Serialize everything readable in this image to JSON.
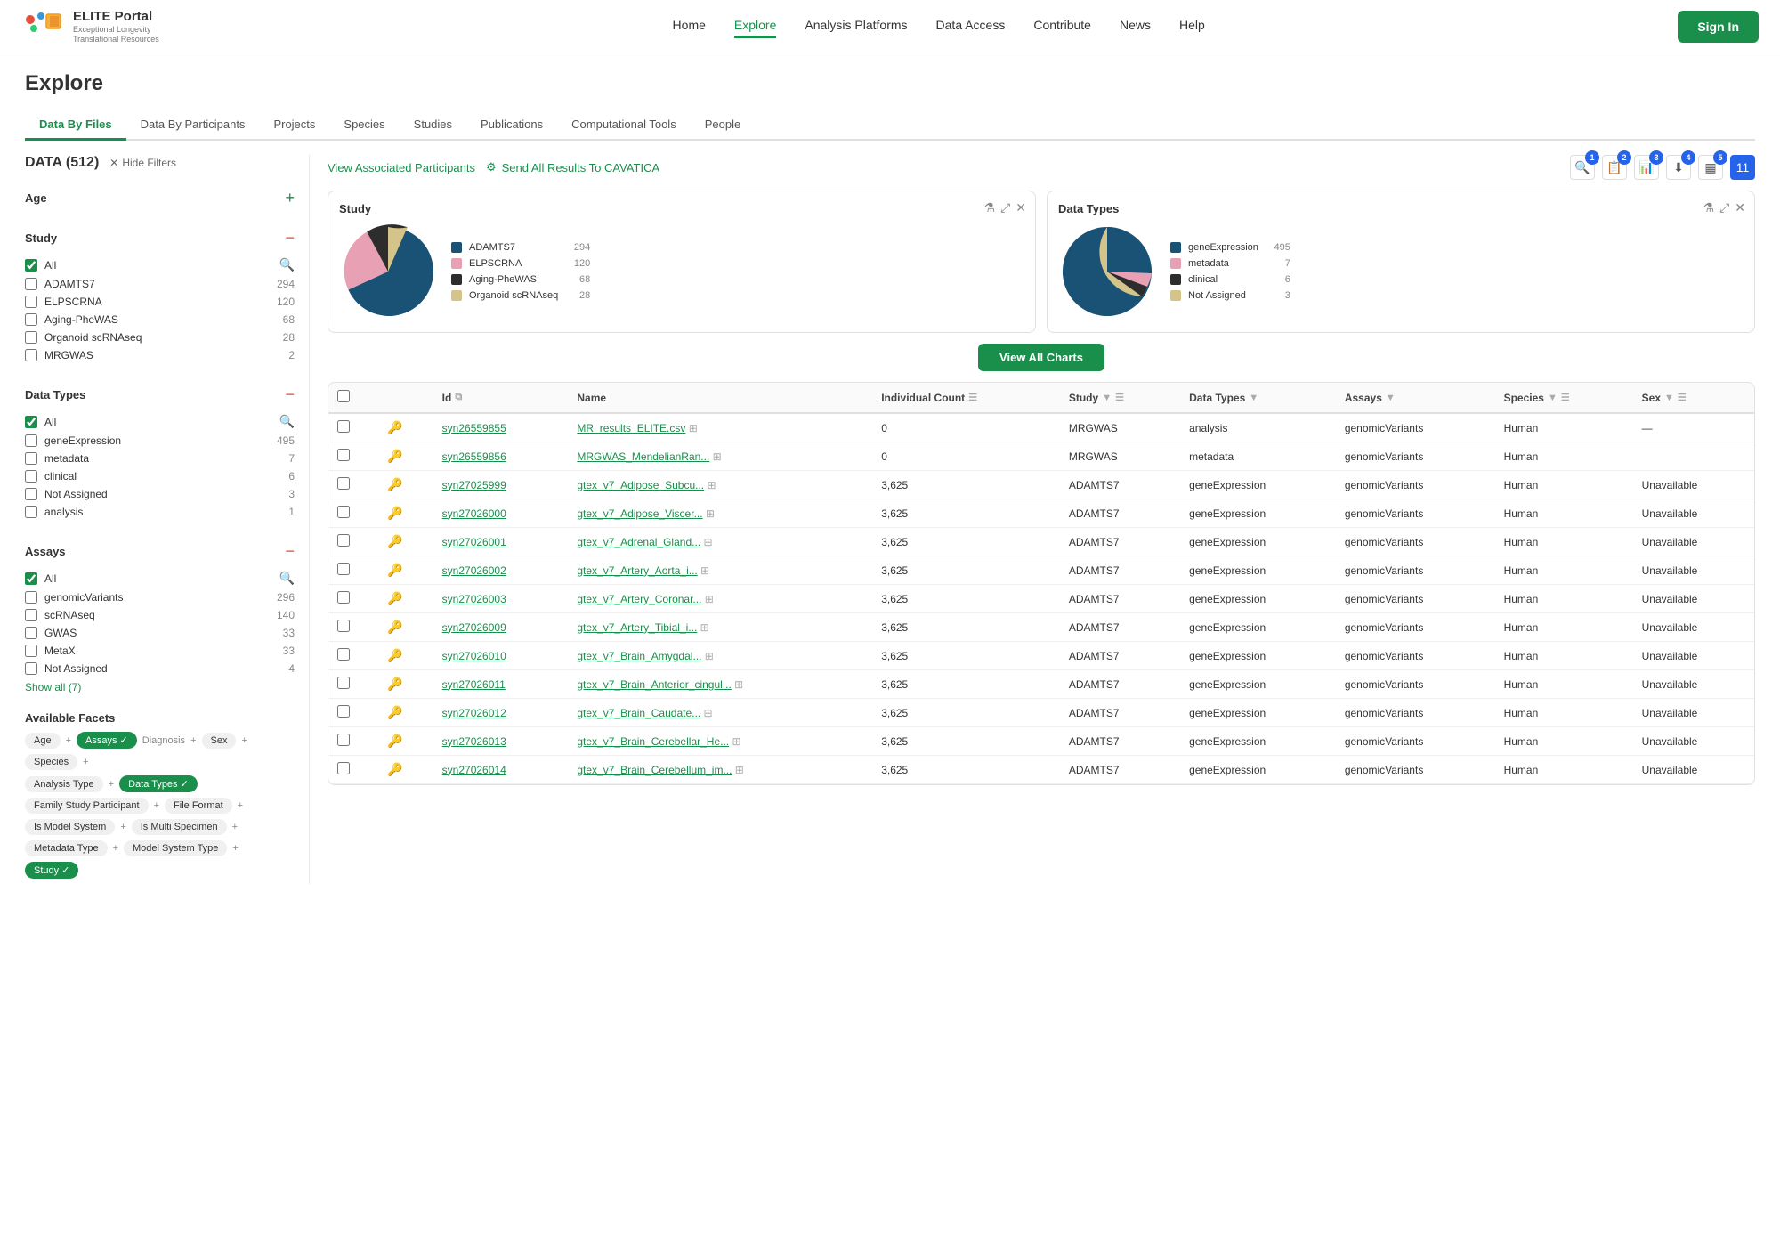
{
  "header": {
    "logo_name": "ELITE Portal",
    "logo_sub": "Exceptional Longevity\nTranslational Resources",
    "nav": [
      {
        "label": "Home",
        "active": false
      },
      {
        "label": "Explore",
        "active": true
      },
      {
        "label": "Analysis Platforms",
        "active": false
      },
      {
        "label": "Data Access",
        "active": false
      },
      {
        "label": "Contribute",
        "active": false
      },
      {
        "label": "News",
        "active": false
      },
      {
        "label": "Help",
        "active": false
      }
    ],
    "sign_in": "Sign In"
  },
  "page": {
    "title": "Explore",
    "tabs": [
      {
        "label": "Data By Files",
        "active": true
      },
      {
        "label": "Data By Participants",
        "active": false
      },
      {
        "label": "Projects",
        "active": false
      },
      {
        "label": "Species",
        "active": false
      },
      {
        "label": "Studies",
        "active": false
      },
      {
        "label": "Publications",
        "active": false
      },
      {
        "label": "Computational Tools",
        "active": false
      },
      {
        "label": "People",
        "active": false
      }
    ]
  },
  "sidebar": {
    "data_count": "DATA (512)",
    "hide_filters": "Hide Filters",
    "sections": [
      {
        "title": "Age",
        "collapsed": false,
        "icon": "+",
        "items": []
      },
      {
        "title": "Study",
        "collapsed": false,
        "icon": "−",
        "has_search": true,
        "items": [
          {
            "label": "All",
            "count": "",
            "checked": true,
            "is_all": true
          },
          {
            "label": "ADAMTS7",
            "count": "294",
            "checked": false
          },
          {
            "label": "ELPSCRNA",
            "count": "120",
            "checked": false
          },
          {
            "label": "Aging-PheWAS",
            "count": "68",
            "checked": false
          },
          {
            "label": "Organoid scRNAseq",
            "count": "28",
            "checked": false
          },
          {
            "label": "MRGWAS",
            "count": "2",
            "checked": false
          }
        ]
      },
      {
        "title": "Data Types",
        "collapsed": false,
        "icon": "−",
        "has_search": true,
        "items": [
          {
            "label": "All",
            "count": "",
            "checked": true,
            "is_all": true
          },
          {
            "label": "geneExpression",
            "count": "495",
            "checked": false
          },
          {
            "label": "metadata",
            "count": "7",
            "checked": false
          },
          {
            "label": "clinical",
            "count": "6",
            "checked": false
          },
          {
            "label": "Not Assigned",
            "count": "3",
            "checked": false
          },
          {
            "label": "analysis",
            "count": "1",
            "checked": false
          }
        ]
      },
      {
        "title": "Assays",
        "collapsed": false,
        "icon": "−",
        "has_search": true,
        "items": [
          {
            "label": "All",
            "count": "",
            "checked": true,
            "is_all": true
          },
          {
            "label": "genomicVariants",
            "count": "296",
            "checked": false
          },
          {
            "label": "scRNAseq",
            "count": "140",
            "checked": false
          },
          {
            "label": "GWAS",
            "count": "33",
            "checked": false
          },
          {
            "label": "MetaX",
            "count": "33",
            "checked": false
          },
          {
            "label": "Not Assigned",
            "count": "4",
            "checked": false
          }
        ],
        "show_all": "Show all (7)"
      }
    ],
    "facets": {
      "title": "Available Facets",
      "rows": [
        [
          {
            "label": "Age",
            "active": false
          },
          {
            "label": "+",
            "is_plus": true
          },
          {
            "label": "Assays",
            "active": true
          },
          {
            "label": "✓",
            "is_check": true
          },
          {
            "label": "Diagnosis",
            "active": false
          },
          {
            "label": "+",
            "is_plus": true
          },
          {
            "label": "Sex",
            "active": false
          },
          {
            "label": "+",
            "is_plus": true
          },
          {
            "label": "Species",
            "active": false
          },
          {
            "label": "+",
            "is_plus": true
          }
        ],
        [
          {
            "label": "Analysis Type",
            "active": false
          },
          {
            "label": "+",
            "is_plus": true
          },
          {
            "label": "Data Types",
            "active": true
          },
          {
            "label": "✓",
            "is_check": true
          }
        ],
        [
          {
            "label": "Family Study Participant",
            "active": false
          },
          {
            "label": "+",
            "is_plus": true
          },
          {
            "label": "File Format",
            "active": false
          },
          {
            "label": "+",
            "is_plus": true
          }
        ],
        [
          {
            "label": "Is Model System",
            "active": false
          },
          {
            "label": "+",
            "is_plus": true
          },
          {
            "label": "Is Multi Specimen",
            "active": false
          },
          {
            "label": "+",
            "is_plus": true
          }
        ],
        [
          {
            "label": "Metadata Type",
            "active": false
          },
          {
            "label": "+",
            "is_plus": true
          },
          {
            "label": "Model System Type",
            "active": false
          },
          {
            "label": "+",
            "is_plus": true
          },
          {
            "label": "Study",
            "active": true
          },
          {
            "label": "✓",
            "is_check": true
          }
        ]
      ]
    }
  },
  "charts": {
    "study": {
      "title": "Study",
      "slices": [
        {
          "label": "ADAMTS7",
          "color": "#1a5276",
          "value": 294,
          "pct": 58
        },
        {
          "label": "ELPSCRNA",
          "color": "#e8a0b4",
          "value": 120,
          "pct": 24
        },
        {
          "label": "Aging-PheWAS",
          "color": "#2d2d2d",
          "value": 68,
          "pct": 13
        },
        {
          "label": "Organoid scRNAseq",
          "color": "#d4c48a",
          "value": 28,
          "pct": 5
        }
      ]
    },
    "data_types": {
      "title": "Data Types",
      "slices": [
        {
          "label": "geneExpression",
          "color": "#1a5276",
          "value": 495,
          "pct": 97
        },
        {
          "label": "metadata",
          "color": "#e8a0b4",
          "value": 7,
          "pct": 1
        },
        {
          "label": "clinical",
          "color": "#2d2d2d",
          "value": 6,
          "pct": 1
        },
        {
          "label": "Not Assigned",
          "color": "#d4c48a",
          "value": 3,
          "pct": 1
        }
      ]
    }
  },
  "view_all_charts": "View All Charts",
  "toolbar": {
    "associated_participants": "View Associated Participants",
    "send_cavatica": "Send All Results To CAVATICA",
    "badges": [
      "1",
      "2",
      "3",
      "4",
      "5",
      "11"
    ]
  },
  "table": {
    "columns": [
      {
        "label": "",
        "key": "checkbox"
      },
      {
        "label": "",
        "key": "icon"
      },
      {
        "label": "Id",
        "key": "id"
      },
      {
        "label": "",
        "key": "copy"
      },
      {
        "label": "Name",
        "key": "name"
      },
      {
        "label": "",
        "key": "expand"
      },
      {
        "label": "Individual Count",
        "key": "individual_count"
      },
      {
        "label": "Study",
        "key": "study"
      },
      {
        "label": "Data Types",
        "key": "data_types"
      },
      {
        "label": "Assays",
        "key": "assays"
      },
      {
        "label": "Species",
        "key": "species"
      },
      {
        "label": "Sex",
        "key": "sex"
      }
    ],
    "rows": [
      {
        "id": "syn26559855",
        "name": "MR_results_ELITE.csv",
        "individual_count": "0",
        "study": "MRGWAS",
        "data_types": "analysis",
        "assays": "genomicVariants",
        "species": "Human",
        "sex": "—"
      },
      {
        "id": "syn26559856",
        "name": "MRGWAS_MendelianRan...",
        "individual_count": "0",
        "study": "MRGWAS",
        "data_types": "metadata",
        "assays": "genomicVariants",
        "species": "Human",
        "sex": ""
      },
      {
        "id": "syn27025999",
        "name": "gtex_v7_Adipose_Subcu...",
        "individual_count": "3,625",
        "study": "ADAMTS7",
        "data_types": "geneExpression",
        "assays": "genomicVariants",
        "species": "Human",
        "sex": "Unavailable"
      },
      {
        "id": "syn27026000",
        "name": "gtex_v7_Adipose_Viscer...",
        "individual_count": "3,625",
        "study": "ADAMTS7",
        "data_types": "geneExpression",
        "assays": "genomicVariants",
        "species": "Human",
        "sex": "Unavailable"
      },
      {
        "id": "syn27026001",
        "name": "gtex_v7_Adrenal_Gland...",
        "individual_count": "3,625",
        "study": "ADAMTS7",
        "data_types": "geneExpression",
        "assays": "genomicVariants",
        "species": "Human",
        "sex": "Unavailable"
      },
      {
        "id": "syn27026002",
        "name": "gtex_v7_Artery_Aorta_i...",
        "individual_count": "3,625",
        "study": "ADAMTS7",
        "data_types": "geneExpression",
        "assays": "genomicVariants",
        "species": "Human",
        "sex": "Unavailable"
      },
      {
        "id": "syn27026003",
        "name": "gtex_v7_Artery_Coronar...",
        "individual_count": "3,625",
        "study": "ADAMTS7",
        "data_types": "geneExpression",
        "assays": "genomicVariants",
        "species": "Human",
        "sex": "Unavailable"
      },
      {
        "id": "syn27026009",
        "name": "gtex_v7_Artery_Tibial_i...",
        "individual_count": "3,625",
        "study": "ADAMTS7",
        "data_types": "geneExpression",
        "assays": "genomicVariants",
        "species": "Human",
        "sex": "Unavailable"
      },
      {
        "id": "syn27026010",
        "name": "gtex_v7_Brain_Amygdal...",
        "individual_count": "3,625",
        "study": "ADAMTS7",
        "data_types": "geneExpression",
        "assays": "genomicVariants",
        "species": "Human",
        "sex": "Unavailable"
      },
      {
        "id": "syn27026011",
        "name": "gtex_v7_Brain_Anterior_cingul...",
        "individual_count": "3,625",
        "study": "ADAMTS7",
        "data_types": "geneExpression",
        "assays": "genomicVariants",
        "species": "Human",
        "sex": "Unavailable"
      },
      {
        "id": "syn27026012",
        "name": "gtex_v7_Brain_Caudate...",
        "individual_count": "3,625",
        "study": "ADAMTS7",
        "data_types": "geneExpression",
        "assays": "genomicVariants",
        "species": "Human",
        "sex": "Unavailable"
      },
      {
        "id": "syn27026013",
        "name": "gtex_v7_Brain_Cerebellar_He...",
        "individual_count": "3,625",
        "study": "ADAMTS7",
        "data_types": "geneExpression",
        "assays": "genomicVariants",
        "species": "Human",
        "sex": "Unavailable"
      },
      {
        "id": "syn27026014",
        "name": "gtex_v7_Brain_Cerebellum_im...",
        "individual_count": "3,625",
        "study": "ADAMTS7",
        "data_types": "geneExpression",
        "assays": "genomicVariants",
        "species": "Human",
        "sex": "Unavailable"
      }
    ]
  }
}
